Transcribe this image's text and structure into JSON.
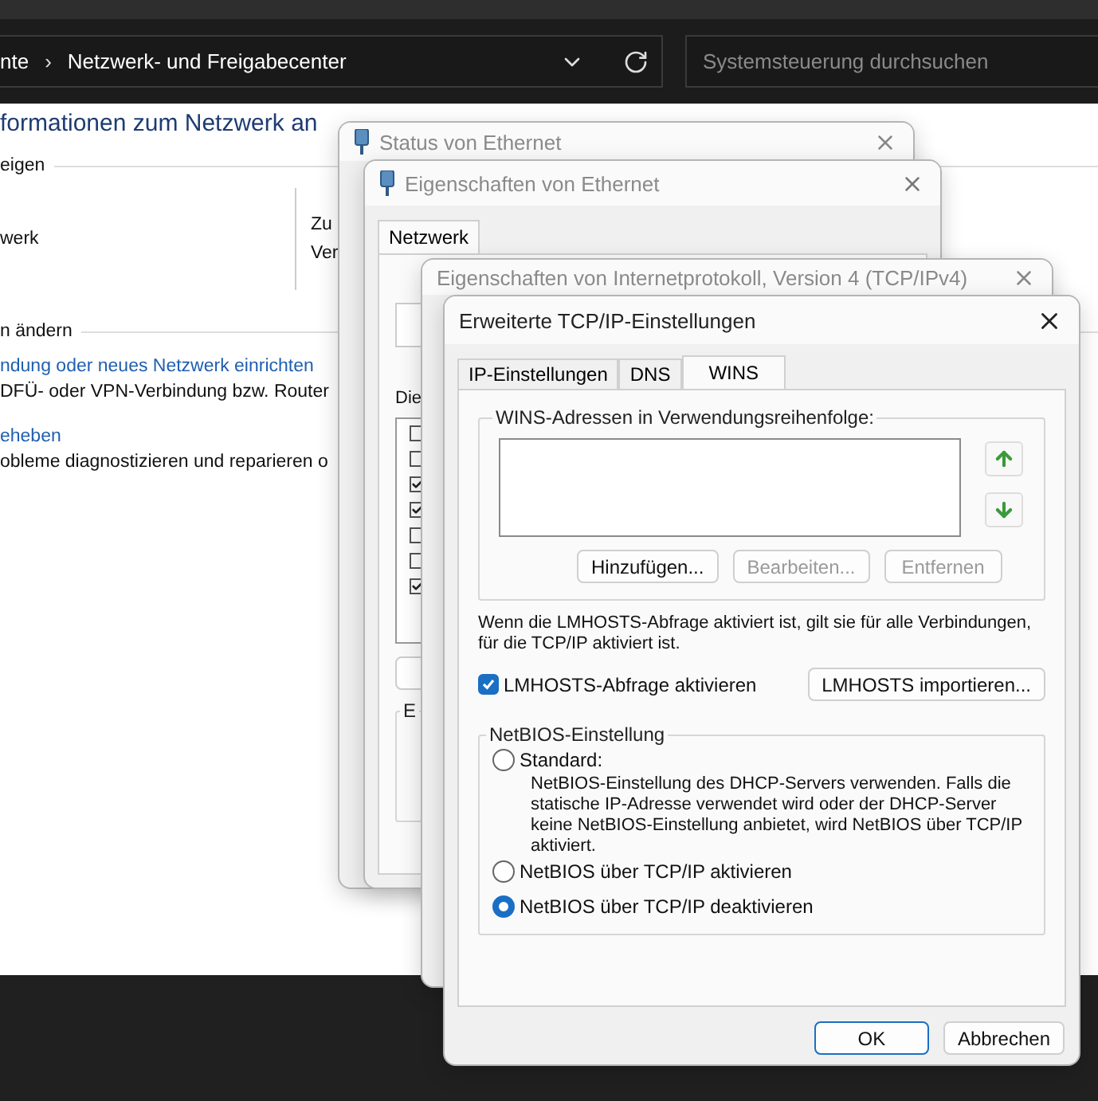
{
  "address_bar": {
    "breadcrumb": [
      {
        "label": "nte"
      },
      {
        "label": "Netzwerk- und Freigabecenter"
      }
    ],
    "separator": "›",
    "search": {
      "placeholder": "Systemsteuerung durchsuchen"
    }
  },
  "page": {
    "heading": "formationen zum Netzwerk an",
    "active_networks_label": "eigen",
    "network_name": "werk",
    "access_labels": [
      "Zu",
      "Ver"
    ],
    "change_settings_label": "n ändern",
    "tasks": [
      {
        "link": "ndung oder neues Netzwerk einrichten",
        "description": "DFÜ- oder VPN-Verbindung bzw. Router"
      },
      {
        "link": "eheben",
        "description": "obleme diagnostizieren und reparieren o"
      }
    ]
  },
  "status_window": {
    "title": "Status von Ethernet"
  },
  "ethernet_properties": {
    "title": "Eigenschaften von Ethernet",
    "tabs": [
      {
        "label": "Netzwerk",
        "selected": true
      }
    ],
    "components_label": "Die",
    "components": [
      {
        "checked": false
      },
      {
        "checked": false
      },
      {
        "checked": true
      },
      {
        "checked": true
      },
      {
        "checked": false
      },
      {
        "checked": false
      },
      {
        "checked": true
      }
    ],
    "group_label": "E"
  },
  "ipv4_properties": {
    "title": "Eigenschaften von Internetprotokoll, Version 4 (TCP/IPv4)"
  },
  "advanced": {
    "title": "Erweiterte TCP/IP-Einstellungen",
    "tabs": [
      {
        "label": "IP-Einstellungen",
        "selected": false
      },
      {
        "label": "DNS",
        "selected": false
      },
      {
        "label": "WINS",
        "selected": true
      }
    ],
    "wins_group": {
      "label": "WINS-Adressen in Verwendungsreihenfolge:",
      "buttons": [
        {
          "label": "Hinzufügen...",
          "disabled": false
        },
        {
          "label": "Bearbeiten...",
          "disabled": true
        },
        {
          "label": "Entfernen",
          "disabled": true
        }
      ]
    },
    "lmhosts_note": "Wenn die LMHOSTS-Abfrage aktiviert ist, gilt sie für alle Verbindungen, für die TCP/IP aktiviert ist.",
    "lmhosts_checkbox": {
      "label": "LMHOSTS-Abfrage aktivieren",
      "checked": true
    },
    "import_button": "LMHOSTS importieren...",
    "netbios_group": {
      "label": "NetBIOS-Einstellung",
      "options": [
        {
          "label": "Standard:",
          "description": "NetBIOS-Einstellung des DHCP-Servers verwenden. Falls die statische IP-Adresse verwendet wird oder der DHCP-Server keine NetBIOS-Einstellung anbietet, wird NetBIOS über TCP/IP aktiviert.",
          "selected": false
        },
        {
          "label": "NetBIOS über TCP/IP aktivieren",
          "selected": false
        },
        {
          "label": "NetBIOS über TCP/IP deaktivieren",
          "selected": true
        }
      ]
    },
    "buttons": [
      {
        "label": "OK",
        "default": true
      },
      {
        "label": "Abbrechen",
        "default": false
      }
    ]
  }
}
